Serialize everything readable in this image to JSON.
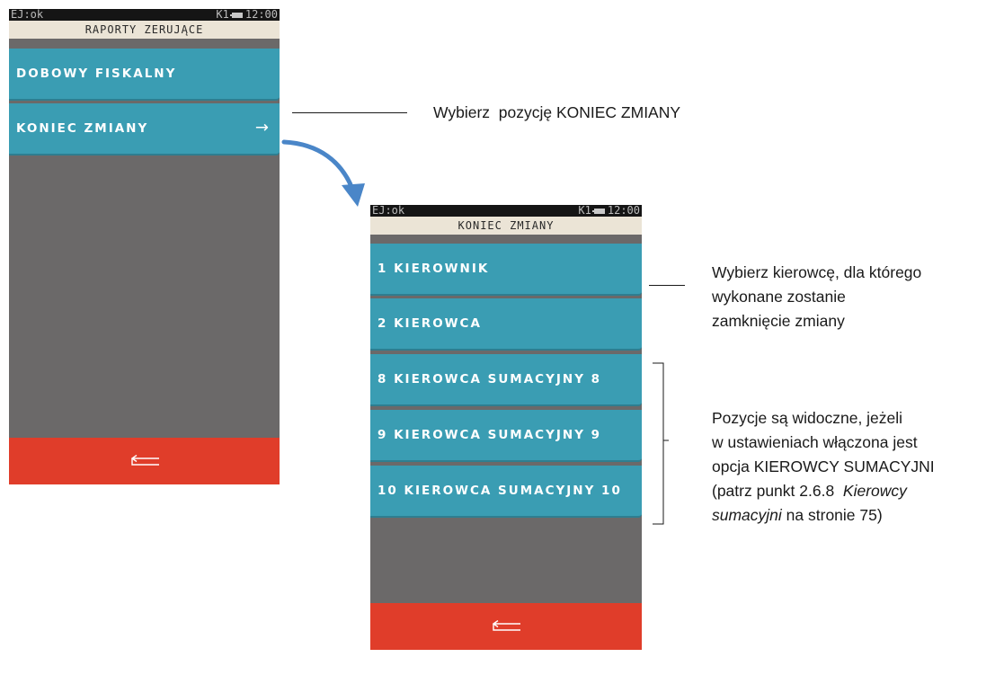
{
  "screen1": {
    "status_left": "EJ:ok",
    "status_kb": "K1",
    "status_time": "12:00",
    "title": "RAPORTY ZERUJĄCE",
    "items": [
      {
        "label": "DOBOWY FISKALNY"
      },
      {
        "label": "KONIEC ZMIANY",
        "arrow": "→"
      }
    ],
    "back_icon": "back-arrow-icon"
  },
  "screen2": {
    "status_left": "EJ:ok",
    "status_kb": "K1",
    "status_time": "12:00",
    "title": "KONIEC ZMIANY",
    "items": [
      {
        "label": "1 KIEROWNIK"
      },
      {
        "label": "2 KIEROWCA"
      },
      {
        "label": "8 KIEROWCA SUMACYJNY 8"
      },
      {
        "label": "9 KIEROWCA SUMACYJNY 9"
      },
      {
        "label": "10 KIEROWCA SUMACYJNY 10"
      }
    ],
    "back_icon": "back-arrow-icon"
  },
  "annotations": {
    "select_koniec": "Wybierz  pozycję KONIEC ZMIANY",
    "select_driver_line1": "Wybierz kierowcę, dla którego",
    "select_driver_line2": "wykonane zostanie",
    "select_driver_line3": "zamknięcie zmiany",
    "visible_line1": "Pozycje są widoczne, jeżeli",
    "visible_line2": "w ustawieniach włączona jest",
    "visible_line3": "opcja KIEROWCY SUMACYJNI",
    "visible_line4_a": "(patrz punkt 2.6.8  ",
    "visible_line4_b": "Kierowcy",
    "visible_line5_a": "sumacyjni",
    "visible_line5_b": " na stronie 75)"
  },
  "colors": {
    "menu_item": "#3a9db3",
    "back_bar": "#e03d2a",
    "screen_bg": "#6b6969",
    "title_bar": "#ebe4d6",
    "flow_arrow": "#4a86c8"
  }
}
